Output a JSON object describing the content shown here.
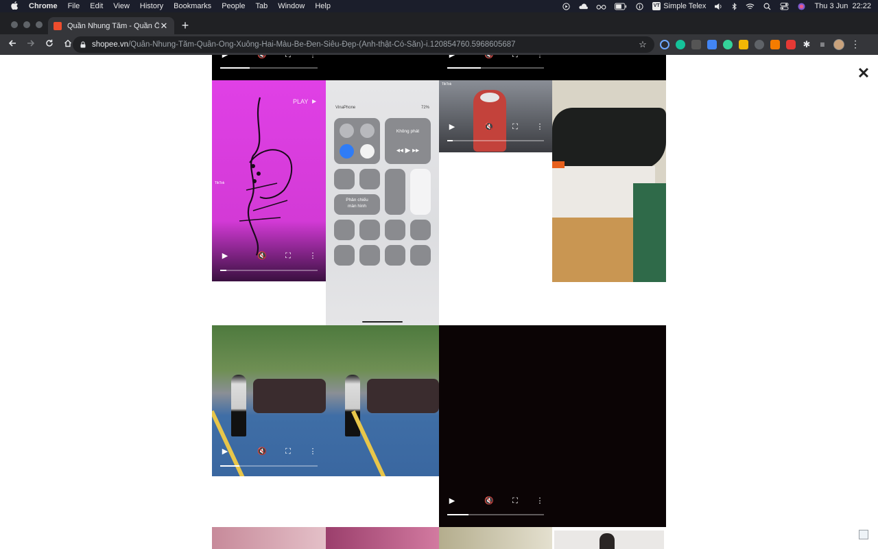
{
  "menubar": {
    "app": "Chrome",
    "items": [
      "File",
      "Edit",
      "View",
      "History",
      "Bookmarks",
      "People",
      "Tab",
      "Window",
      "Help"
    ],
    "input_method": "Simple Telex",
    "input_badge": "VT",
    "datetime": "Thu 3 Jun  22:22"
  },
  "browser": {
    "tab_title": "Quần Nhung Tăm - Quần Ống ",
    "url_host": "shopee.vn",
    "url_path": "/Quần-Nhung-Tăm-Quần-Ống-Xuông-Hai-Màu-Be-Đen-Siêu-Đẹp-(Ảnh-thật-Có-Sẵn)-i.120854760.5968605687"
  },
  "viewer": {
    "close_label": "✕"
  },
  "tiles": {
    "tiktok_tile": {
      "play_label": "PLAY",
      "watermark": "TikTok",
      "progress": 0.2
    },
    "scooter_tile": {
      "watermark": "TikTok",
      "progress": 0.2
    },
    "top_left_progress": 0.3,
    "top_right_progress": 0.35,
    "parking_tile_progress": 0.2,
    "dark_tile_progress": 0.22
  },
  "control_center": {
    "carrier": "VinaPhone",
    "battery": "72%",
    "now_playing": "Không phát",
    "screen_mirroring": "Phản chiếu màn hình"
  },
  "colors": {
    "menubar_bg": "#1b1e2b",
    "chrome_bg": "#202124",
    "toolbar_bg": "#35363a",
    "shopee_orange": "#ee4d2d",
    "tiktok_magenta": "#d93ad8"
  },
  "icons": {
    "apple": "apple-icon",
    "back": "back-arrow-icon",
    "forward": "forward-arrow-icon",
    "reload": "reload-icon",
    "home": "home-icon",
    "bookmark": "star-icon",
    "play": "play-icon",
    "mute": "mute-icon",
    "fullscreen": "fullscreen-icon",
    "more": "more-vert-icon"
  }
}
